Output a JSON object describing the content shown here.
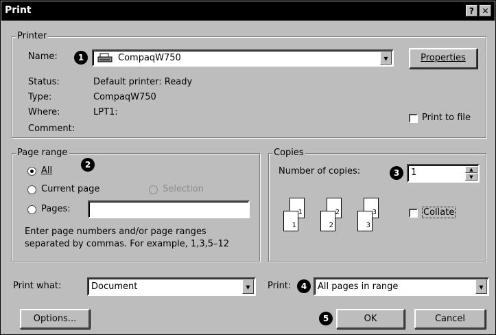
{
  "window": {
    "title": "Print",
    "help_label": "?",
    "close_label": "✕"
  },
  "printer": {
    "legend": "Printer",
    "name_label": "Name:",
    "name_value": "CompaqW750",
    "properties_label": "Properties",
    "status_label": "Status:",
    "status_value": "Default printer: Ready",
    "type_label": "Type:",
    "type_value": "CompaqW750",
    "where_label": "Where:",
    "where_value": "LPT1:",
    "comment_label": "Comment:",
    "print_to_file_label": "Print to file"
  },
  "page_range": {
    "legend": "Page range",
    "all_label": "All",
    "current_page_label": "Current page",
    "selection_label": "Selection",
    "pages_label": "Pages:",
    "pages_value": "",
    "hint_line1": "Enter page numbers and/or page ranges",
    "hint_line2": "separated by commas.  For example, 1,3,5–12"
  },
  "copies": {
    "legend": "Copies",
    "number_label": "Number of copies:",
    "number_value": "1",
    "collate_label": "Collate",
    "sheet_numbers": [
      "1",
      "1",
      "2",
      "2",
      "3",
      "3"
    ]
  },
  "print_what": {
    "label": "Print what:",
    "value": "Document"
  },
  "print": {
    "label": "Print:",
    "value": "All pages in range"
  },
  "buttons": {
    "options": "Options...",
    "ok": "OK",
    "cancel": "Cancel"
  },
  "callouts": [
    "1",
    "2",
    "3",
    "4",
    "5"
  ],
  "icons": {
    "printer": "printer-icon",
    "dropdown": "dropdown-arrow-icon",
    "spin": "spin-arrows-icon"
  }
}
